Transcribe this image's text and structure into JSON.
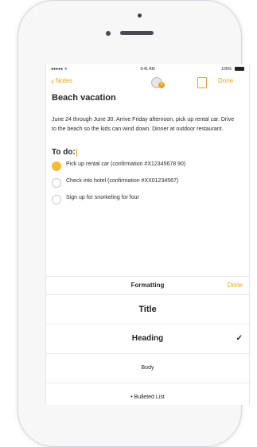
{
  "status_bar": {
    "carrier": "●●●●● ᯤ",
    "time": "9:41 AM",
    "battery": "100%"
  },
  "nav": {
    "back_label": "Notes",
    "done_label": "Done"
  },
  "note": {
    "title": "Beach vacation",
    "paragraph": "June 24 through June 30. Arrive Friday afternoon, pick up rental car. Drive to the beach so the kids can wind down. Dinner at outdoor restaurant.",
    "todo_heading": "To do:",
    "todos": [
      {
        "text": "Pick up rental car (confirmation #X12345678 90)",
        "checked": true
      },
      {
        "text": "Check into hotel (confirmation #XX01234567)",
        "checked": false
      },
      {
        "text": "Sign up for snorkeling for four",
        "checked": false
      }
    ]
  },
  "formatting": {
    "header": "Formatting",
    "done_label": "Done",
    "options": {
      "title": "Title",
      "heading": "Heading",
      "body": "Body",
      "bulleted_list": "• Bulleted List"
    },
    "selected": "Heading",
    "checkmark": "✓"
  },
  "colors": {
    "accent": "#e6a323",
    "checked_circle": "#f3bb3a"
  }
}
